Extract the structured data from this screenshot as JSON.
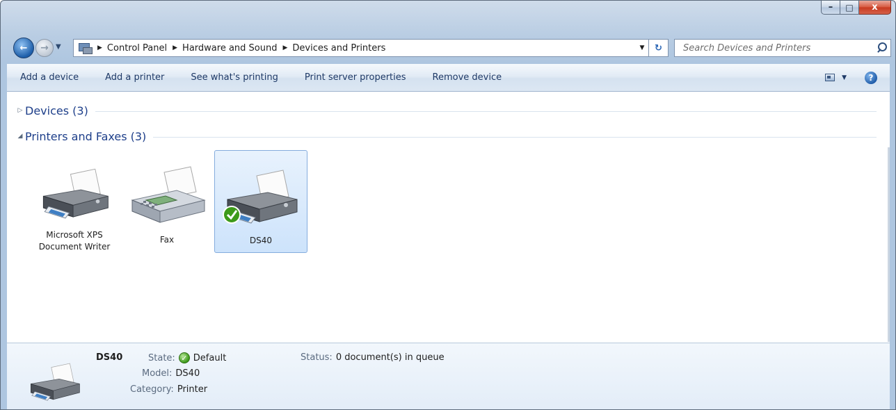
{
  "window": {
    "minimize_glyph": "–",
    "maximize_glyph": "□",
    "close_glyph": "x"
  },
  "address": {
    "back_glyph": "←",
    "forward_glyph": "→",
    "history_glyph": "▼",
    "breadcrumbs": [
      "Control Panel",
      "Hardware and Sound",
      "Devices and Printers"
    ],
    "separator_glyph": "▶",
    "dropdown_glyph": "▼",
    "refresh_glyph": "↻",
    "search_placeholder": "Search Devices and Printers"
  },
  "command_bar": {
    "items": [
      "Add a device",
      "Add a printer",
      "See what's printing",
      "Print server properties",
      "Remove device"
    ],
    "view_caret_glyph": "▼",
    "help_glyph": "?"
  },
  "groups": [
    {
      "toggle_glyph": "▷",
      "title": "Devices (3)",
      "expanded": false
    },
    {
      "toggle_glyph": "◢",
      "title": "Printers and Faxes (3)",
      "expanded": true
    }
  ],
  "devices": [
    {
      "label": "Microsoft XPS Document Writer",
      "icon": "printer-icon",
      "selected": false,
      "default": false
    },
    {
      "label": "Fax",
      "icon": "fax-icon",
      "selected": false,
      "default": false
    },
    {
      "label": "DS40",
      "icon": "printer-icon",
      "selected": true,
      "default": true
    }
  ],
  "details": {
    "name": "DS40",
    "state_label": "State:",
    "state_value": "Default",
    "check_glyph": "✓",
    "model_label": "Model:",
    "model_value": "DS40",
    "category_label": "Category:",
    "category_value": "Printer",
    "status_label": "Status:",
    "status_value": "0 document(s) in queue"
  },
  "colors": {
    "accent": "#1e3f8a",
    "selection": "#cde3fb",
    "default_check": "#3d9a1a"
  }
}
